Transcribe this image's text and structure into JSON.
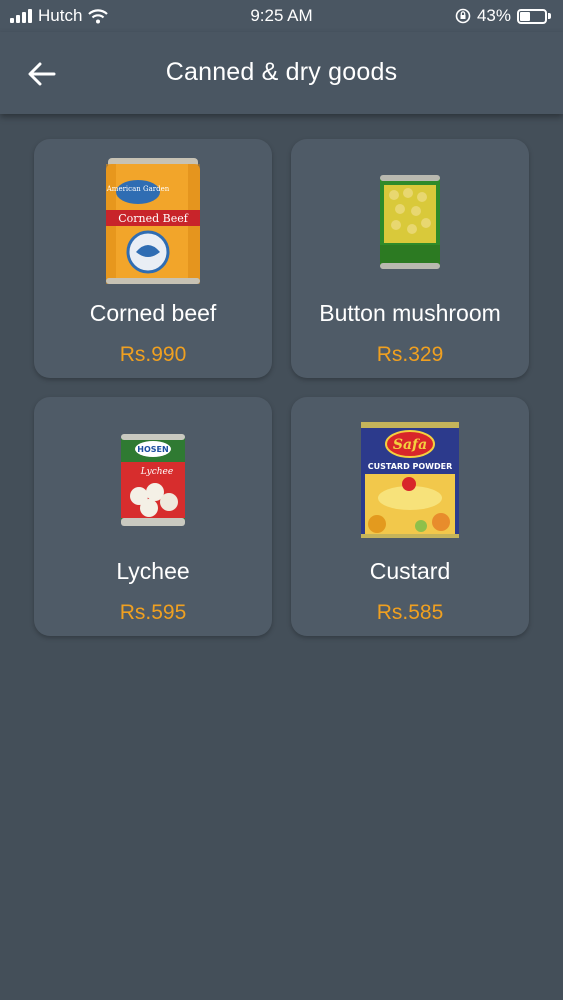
{
  "status_bar": {
    "carrier": "Hutch",
    "time": "9:25 AM",
    "battery_percent": "43%",
    "battery_level": 0.43
  },
  "header": {
    "title": "Canned & dry goods",
    "back_icon": "arrow-left-icon"
  },
  "products": [
    {
      "name": "Corned beef",
      "price": "Rs.990",
      "image": "corned-beef-can"
    },
    {
      "name": "Button mushroom",
      "price": "Rs.329",
      "image": "mushroom-can"
    },
    {
      "name": "Lychee",
      "price": "Rs.595",
      "image": "lychee-can"
    },
    {
      "name": "Custard",
      "price": "Rs.585",
      "image": "custard-powder-tin"
    }
  ],
  "can_labels": {
    "corned_beef_brand": "American Garden",
    "corned_beef_label": "Corned Beef",
    "lychee_brand": "HOSEN",
    "lychee_label": "Lychee",
    "custard_brand": "Safa",
    "custard_label": "CUSTARD POWDER"
  },
  "colors": {
    "background": "#444f59",
    "bar": "#4a5662",
    "card": "#4f5b67",
    "price": "#f0a020"
  }
}
